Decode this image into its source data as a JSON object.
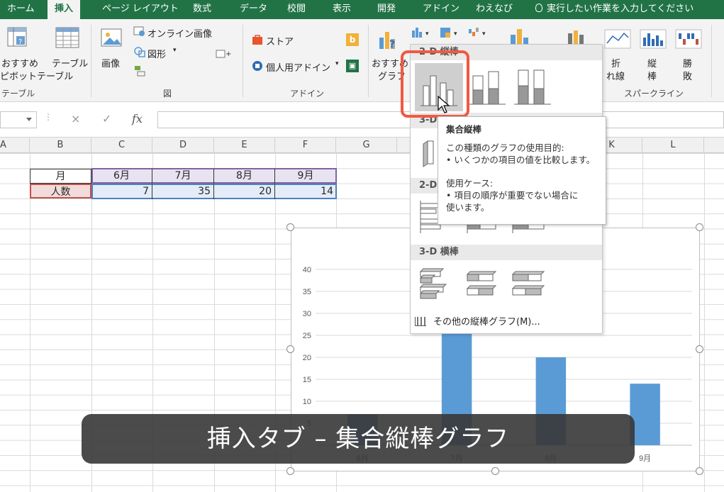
{
  "ribbon_tabs": [
    {
      "label": "ホーム"
    },
    {
      "label": "挿入"
    },
    {
      "label": "ページ レイアウト"
    },
    {
      "label": "数式"
    },
    {
      "label": "データ"
    },
    {
      "label": "校閲"
    },
    {
      "label": "表示"
    },
    {
      "label": "開発"
    },
    {
      "label": "アドイン"
    },
    {
      "label": "わえなび"
    }
  ],
  "active_tab": "挿入",
  "tell_me": "実行したい作業を入力してください",
  "ribbon": {
    "pivot_line1": "おすすめ",
    "pivot_line2": "ピボットテーブル",
    "table": "テーブル",
    "group_table": "テーブル",
    "picture": "画像",
    "online_pictures": "オンライン画像",
    "shapes": "図形",
    "group_illustrations": "図",
    "store": "ストア",
    "my_addins": "個人用アドイン",
    "group_addins": "アドイン",
    "rec_chart_line1": "おすすめ",
    "rec_chart_line2": "グラフ",
    "spark_line_1": "折",
    "spark_line_2": "れ線",
    "spark_col_1": "縦",
    "spark_col_2": "棒",
    "spark_wl_1": "勝",
    "spark_wl_2": "敗",
    "group_sparklines": "スパークライン"
  },
  "formula_bar": {
    "cancel": "×",
    "enter": "✓",
    "fx": "fx"
  },
  "columns": [
    "A",
    "B",
    "C",
    "D",
    "E",
    "F",
    "G",
    "K",
    "L"
  ],
  "cells": {
    "month_header": "月",
    "months": [
      "6月",
      "7月",
      "8月",
      "9月"
    ],
    "count_header": "人数",
    "counts": [
      "7",
      "35",
      "20",
      "14"
    ]
  },
  "chart_data": {
    "type": "bar",
    "categories": [
      "6月",
      "7月",
      "8月",
      "9月"
    ],
    "values": [
      7,
      35,
      20,
      14
    ],
    "ylim": [
      0,
      40
    ],
    "yticks": [
      0,
      5,
      10,
      15,
      20,
      25,
      30,
      35,
      40
    ],
    "grid": true,
    "color": "#5b9bd5"
  },
  "gallery": {
    "sec_2d_column": "2-D 縦棒",
    "sec_3d_column": "3-D",
    "sec_2d_bar": "2-D",
    "sec_3d_bar": "3-D 横棒",
    "more_charts": "その他の縦棒グラフ(M)..."
  },
  "tooltip": {
    "title": "集合縦棒",
    "purpose": "この種類のグラフの使用目的:",
    "purpose_item": "• いくつかの項目の値を比較します。",
    "usecase": "使用ケース:",
    "usecase_item1": "• 項目の順序が重要でない場合に",
    "usecase_item2": "使います。"
  },
  "caption": "挿入タブ – 集合縦棒グラフ",
  "colors": {
    "ribbon_green": "#217346",
    "bar_blue": "#5b9bd5",
    "highlight": "#f05a41",
    "selection_purple": "#8064a2",
    "selection_red": "#c0504d"
  }
}
